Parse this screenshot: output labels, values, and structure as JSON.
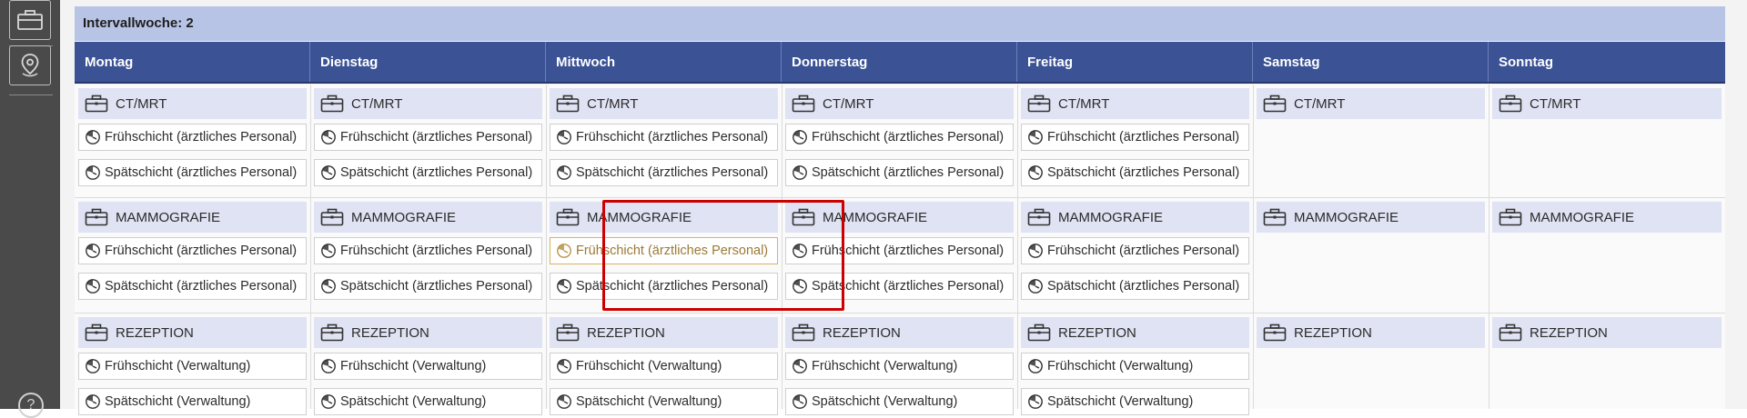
{
  "week_label": "Intervallwoche: 2",
  "days": [
    "Montag",
    "Dienstag",
    "Mittwoch",
    "Donnerstag",
    "Freitag",
    "Samstag",
    "Sonntag"
  ],
  "categories": [
    {
      "name": "CT/MRT",
      "shifts": [
        "Frühschicht (ärztliches Personal)",
        "Spätschicht (ärztliches Personal)"
      ]
    },
    {
      "name": "MAMMOGRAFIE",
      "shifts": [
        "Frühschicht (ärztliches Personal)",
        "Spätschicht (ärztliches Personal)"
      ]
    },
    {
      "name": "REZEPTION",
      "shifts": [
        "Frühschicht (Verwaltung)",
        "Spätschicht (Verwaltung)"
      ]
    }
  ],
  "shift_days": 5,
  "colors": {
    "header": "#3b5294",
    "week_bar": "#b7c4e6",
    "category_bg": "#dfe3f3",
    "selection_border": "#cc0000",
    "hover_border": "#d8b45e"
  },
  "icons": {
    "category": "briefcase-icon",
    "shift": "clock-icon",
    "sidebar": [
      "briefcase-icon",
      "map-pin-icon",
      "help-icon"
    ]
  },
  "sidebar": {
    "help_label": "?"
  }
}
